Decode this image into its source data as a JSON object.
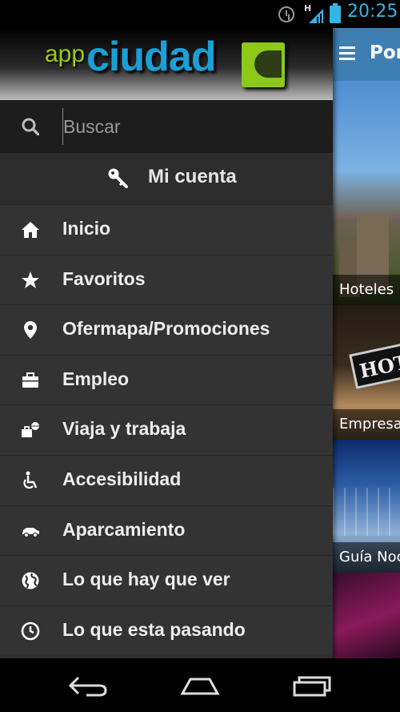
{
  "status_bar": {
    "network_type": "H",
    "time": "20:25"
  },
  "drawer": {
    "logo": {
      "prefix": "app",
      "name": "ciudad"
    },
    "search": {
      "placeholder": "Buscar"
    },
    "account_label": "Mi cuenta",
    "items": [
      {
        "label": "Inicio",
        "icon": "home-icon"
      },
      {
        "label": "Favoritos",
        "icon": "star-icon"
      },
      {
        "label": "Ofermapa/Promociones",
        "icon": "map-pin-icon"
      },
      {
        "label": "Empleo",
        "icon": "briefcase-icon"
      },
      {
        "label": "Viaja y trabaja",
        "icon": "travel-icon"
      },
      {
        "label": "Accesibilidad",
        "icon": "wheelchair-icon"
      },
      {
        "label": "Aparcamiento",
        "icon": "car-icon"
      },
      {
        "label": "Lo que hay que ver",
        "icon": "globe-icon"
      },
      {
        "label": "Lo que esta pasando",
        "icon": "clock-icon"
      }
    ]
  },
  "content": {
    "title": "Por",
    "tiles": [
      {
        "label": "Hoteles"
      },
      {
        "label": "Empresa"
      },
      {
        "label": "Guía Noc"
      }
    ],
    "hotel_sign": "HOT"
  },
  "colors": {
    "accent_blue": "#3e7fb3",
    "status_blue": "#33b5e5",
    "logo_green": "#8ec81a",
    "logo_blue": "#1aa0d6",
    "drawer_bg": "#333333"
  }
}
